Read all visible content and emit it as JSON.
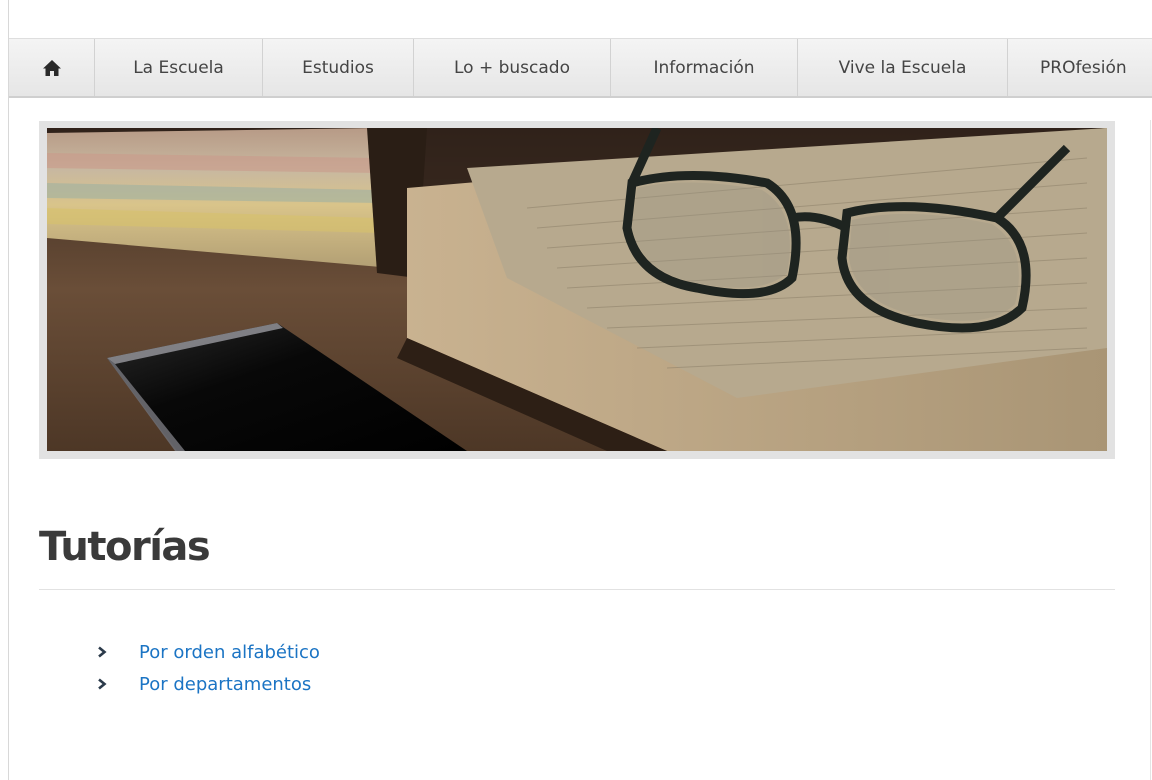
{
  "nav": {
    "home_icon": "home-icon",
    "items": [
      {
        "label": "La Escuela"
      },
      {
        "label": "Estudios"
      },
      {
        "label": "Lo + buscado"
      },
      {
        "label": "Información"
      },
      {
        "label": "Vive la Escuela"
      },
      {
        "label": "PROfesión"
      }
    ]
  },
  "banner": {
    "description_icon": "banner-image"
  },
  "page": {
    "title": "Tutorías"
  },
  "links": [
    {
      "label": "Por orden alfabético",
      "icon": "chevron-right-icon"
    },
    {
      "label": "Por departamentos",
      "icon": "chevron-right-icon"
    }
  ],
  "colors": {
    "link": "#1b74c4",
    "title": "#3a3a3a",
    "nav_text": "#444444",
    "chevron": "#2b3a4a"
  }
}
